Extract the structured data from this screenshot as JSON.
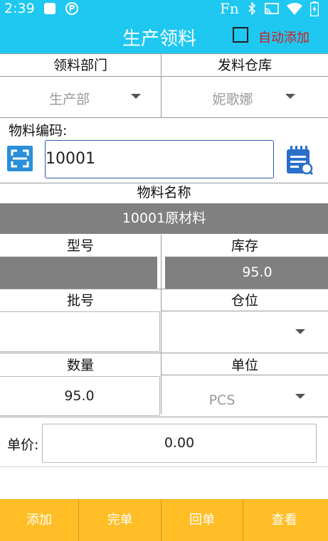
{
  "status_bar": {
    "time": "2:39",
    "fn_label": "Fn",
    "icons": [
      "notification-square-icon",
      "p-circle-icon",
      "bluetooth-icon",
      "cast-icon",
      "wifi-icon",
      "battery-icon"
    ]
  },
  "header": {
    "title": "生产领料",
    "auto_add_label": "自动添加",
    "auto_add_checked": false
  },
  "fields": {
    "dept_header": "领料部门",
    "warehouse_header": "发料仓库",
    "dept_value": "生产部",
    "warehouse_value": "妮歌娜",
    "material_code_label": "物料编码:",
    "material_code_value": "10001",
    "material_name_header": "物料名称",
    "material_name_value": "10001原材料",
    "model_header": "型号",
    "stock_header": "库存",
    "model_value": "",
    "stock_value": "95.0",
    "batch_header": "批号",
    "location_header": "仓位",
    "batch_value": "",
    "location_value": "",
    "quantity_header": "数量",
    "unit_header": "单位",
    "quantity_value": "95.0",
    "unit_value": "PCS",
    "price_label": "单价:",
    "price_value": "0.00"
  },
  "bottom_bar": {
    "add_label": "添加",
    "complete_label": "完单",
    "return_label": "回单",
    "view_label": "查看"
  },
  "colors": {
    "header_bg": "#1ec8f0",
    "bottom_bg": "#ffbe26",
    "gray_bar": "#808080",
    "auto_add_text": "#d41c1c",
    "scan_button": "#2a8fd8"
  }
}
